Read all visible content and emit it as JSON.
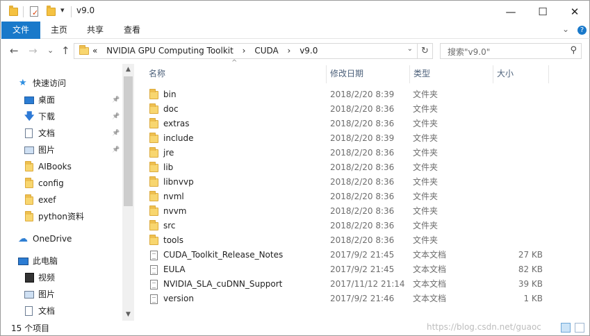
{
  "window": {
    "title": "v9.0",
    "minimize_glyph": "—",
    "maximize_glyph": "☐",
    "close_glyph": "✕"
  },
  "quick_access_toolbar": {
    "dropdown_glyph": "▾"
  },
  "ribbon": {
    "tabs": [
      "文件",
      "主页",
      "共享",
      "查看"
    ],
    "collapse_glyph": "⌄",
    "help_glyph": "?"
  },
  "navigation": {
    "back_glyph": "←",
    "forward_glyph": "→",
    "recent_glyph": "⌄",
    "up_glyph": "↑"
  },
  "address_bar": {
    "overflow": "«",
    "crumbs": [
      "NVIDIA GPU Computing Toolkit",
      "CUDA",
      "v9.0"
    ],
    "separator": "›",
    "dropdown_glyph": "⌄",
    "refresh_glyph": "↻"
  },
  "search": {
    "placeholder": "搜索\"v9.0\"",
    "icon_glyph": "⚲"
  },
  "sidebar": {
    "quick_access": {
      "label": "快速访问"
    },
    "pinned": [
      {
        "label": "桌面",
        "pin": "📌"
      },
      {
        "label": "下载",
        "pin": "📌"
      },
      {
        "label": "文档",
        "pin": "📌"
      },
      {
        "label": "图片",
        "pin": "📌"
      }
    ],
    "folders": [
      {
        "label": "AIBooks"
      },
      {
        "label": "config"
      },
      {
        "label": "exef"
      },
      {
        "label": "python资料"
      }
    ],
    "onedrive": {
      "label": "OneDrive"
    },
    "this_pc": {
      "label": "此电脑"
    },
    "pc_items": [
      {
        "label": "视频"
      },
      {
        "label": "图片"
      },
      {
        "label": "文档"
      }
    ],
    "scroll_up_glyph": "▲",
    "scroll_down_glyph": "▼"
  },
  "file_list": {
    "columns": {
      "name": "名称",
      "date": "修改日期",
      "type": "类型",
      "size": "大小"
    },
    "sort_glyph": "^",
    "rows": [
      {
        "name": "bin",
        "date": "2018/2/20 8:39",
        "type": "文件夹",
        "size": "",
        "kind": "folder"
      },
      {
        "name": "doc",
        "date": "2018/2/20 8:36",
        "type": "文件夹",
        "size": "",
        "kind": "folder"
      },
      {
        "name": "extras",
        "date": "2018/2/20 8:36",
        "type": "文件夹",
        "size": "",
        "kind": "folder"
      },
      {
        "name": "include",
        "date": "2018/2/20 8:39",
        "type": "文件夹",
        "size": "",
        "kind": "folder"
      },
      {
        "name": "jre",
        "date": "2018/2/20 8:36",
        "type": "文件夹",
        "size": "",
        "kind": "folder"
      },
      {
        "name": "lib",
        "date": "2018/2/20 8:36",
        "type": "文件夹",
        "size": "",
        "kind": "folder"
      },
      {
        "name": "libnvvp",
        "date": "2018/2/20 8:36",
        "type": "文件夹",
        "size": "",
        "kind": "folder"
      },
      {
        "name": "nvml",
        "date": "2018/2/20 8:36",
        "type": "文件夹",
        "size": "",
        "kind": "folder"
      },
      {
        "name": "nvvm",
        "date": "2018/2/20 8:36",
        "type": "文件夹",
        "size": "",
        "kind": "folder"
      },
      {
        "name": "src",
        "date": "2018/2/20 8:36",
        "type": "文件夹",
        "size": "",
        "kind": "folder"
      },
      {
        "name": "tools",
        "date": "2018/2/20 8:36",
        "type": "文件夹",
        "size": "",
        "kind": "folder"
      },
      {
        "name": "CUDA_Toolkit_Release_Notes",
        "date": "2017/9/2 21:45",
        "type": "文本文档",
        "size": "27 KB",
        "kind": "text"
      },
      {
        "name": "EULA",
        "date": "2017/9/2 21:45",
        "type": "文本文档",
        "size": "82 KB",
        "kind": "text"
      },
      {
        "name": "NVIDIA_SLA_cuDNN_Support",
        "date": "2017/11/12 21:14",
        "type": "文本文档",
        "size": "39 KB",
        "kind": "text"
      },
      {
        "name": "version",
        "date": "2017/9/2 21:46",
        "type": "文本文档",
        "size": "1 KB",
        "kind": "text"
      }
    ]
  },
  "status_bar": {
    "item_count": "15 个项目",
    "watermark": "https://blog.csdn.net/guaoc"
  },
  "colors": {
    "file_tab": "#1979ca",
    "folder": "#f8d66f",
    "accent": "#2e8ee0"
  }
}
